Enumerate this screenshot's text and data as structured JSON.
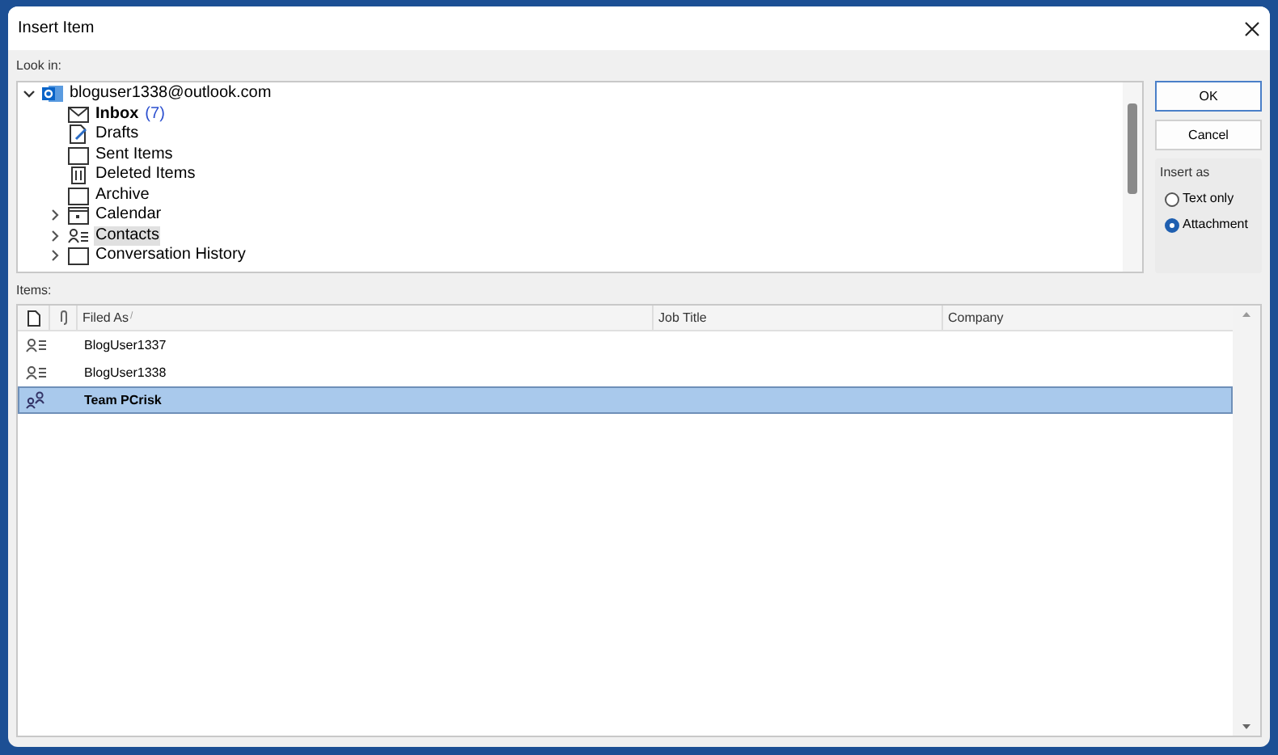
{
  "window": {
    "title": "Insert Item"
  },
  "look_in": {
    "label": "Look in:",
    "tree": [
      {
        "kind": "account",
        "label": "bloguser1338@outlook.com",
        "expanded": true,
        "children": [
          {
            "kind": "mail",
            "label": "Inbox",
            "count": "(7)",
            "bold": true
          },
          {
            "kind": "drafts",
            "label": "Drafts"
          },
          {
            "kind": "folder",
            "label": "Sent Items"
          },
          {
            "kind": "trash",
            "label": "Deleted Items"
          },
          {
            "kind": "folder",
            "label": "Archive"
          },
          {
            "kind": "calendar",
            "label": "Calendar",
            "expanded": false
          },
          {
            "kind": "contacts",
            "label": "Contacts",
            "expanded": false,
            "selected": true
          },
          {
            "kind": "folder",
            "label": "Conversation History",
            "expanded": false
          }
        ]
      }
    ]
  },
  "buttons": [
    {
      "label": "OK",
      "default": true
    },
    {
      "label": "Cancel",
      "default": false
    }
  ],
  "insert_as": {
    "label": "Insert as",
    "options": [
      {
        "label": "Text only",
        "selected": false
      },
      {
        "label": "Attachment",
        "selected": true
      }
    ]
  },
  "items": {
    "label": "Items:",
    "columns": [
      "Filed As",
      "Job Title",
      "Company"
    ],
    "sort_mark": "/",
    "rows": [
      {
        "kind": "contact",
        "filed_as": "BlogUser1337",
        "selected": false
      },
      {
        "kind": "contact",
        "filed_as": "BlogUser1338",
        "selected": false
      },
      {
        "kind": "group",
        "filed_as": "Team PCrisk",
        "selected": true
      }
    ]
  }
}
